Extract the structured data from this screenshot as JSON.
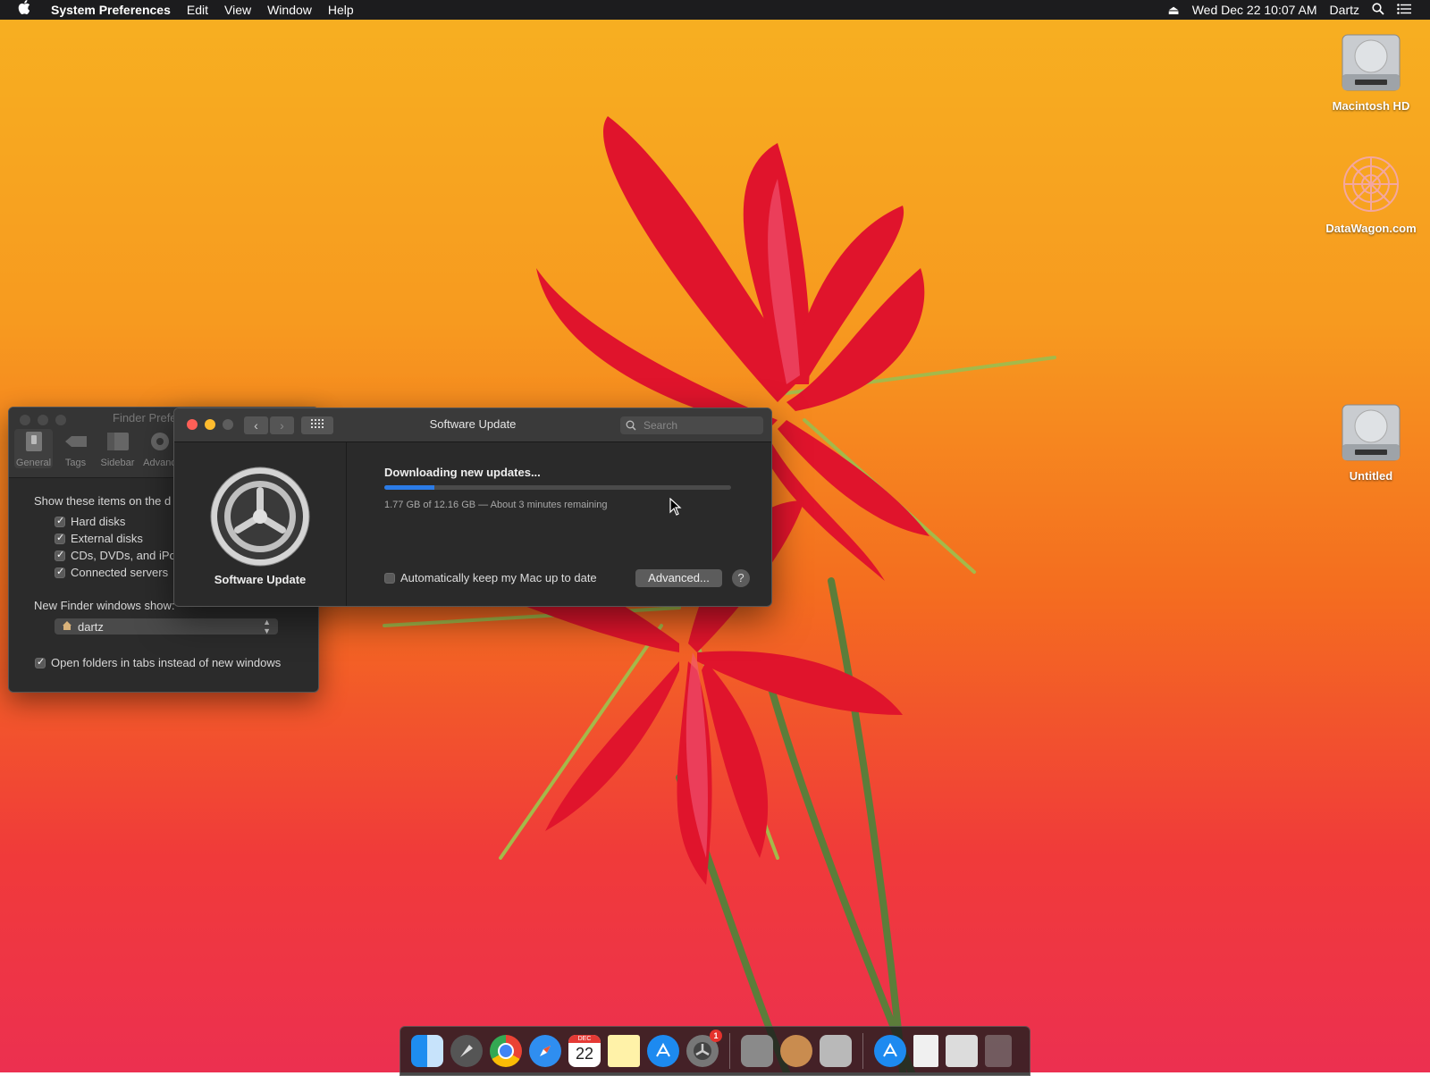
{
  "menubar": {
    "app": "System Preferences",
    "items": [
      "Edit",
      "View",
      "Window",
      "Help"
    ],
    "datetime": "Wed Dec 22  10:07 AM",
    "user": "Dartz"
  },
  "desktop_icons": {
    "macintosh_hd": "Macintosh HD",
    "datawagon": "DataWagon.com",
    "untitled": "Untitled"
  },
  "finder_prefs": {
    "title": "Finder Prefe",
    "tabs": [
      "General",
      "Tags",
      "Sidebar",
      "Advanc"
    ],
    "show_items_label": "Show these items on the d",
    "items": [
      "Hard disks",
      "External disks",
      "CDs, DVDs, and iPo",
      "Connected servers"
    ],
    "new_windows_label": "New Finder windows show:",
    "new_windows_value": "dartz",
    "open_in_tabs": "Open folders in tabs instead of new windows"
  },
  "software_update": {
    "title": "Software Update",
    "search_placeholder": "Search",
    "pane_label": "Software Update",
    "status": "Downloading new updates...",
    "progress_fraction": 0.145,
    "detail": "1.77 GB of 12.16 GB — About 3 minutes remaining",
    "auto_update": "Automatically keep my Mac up to date",
    "advanced": "Advanced...",
    "help": "?"
  },
  "dock": {
    "calendar_month": "DEC",
    "calendar_day": "22",
    "badge": "1"
  },
  "colors": {
    "progress": "#2b7be6",
    "close": "#fe5f57",
    "minimize": "#febc2e"
  }
}
